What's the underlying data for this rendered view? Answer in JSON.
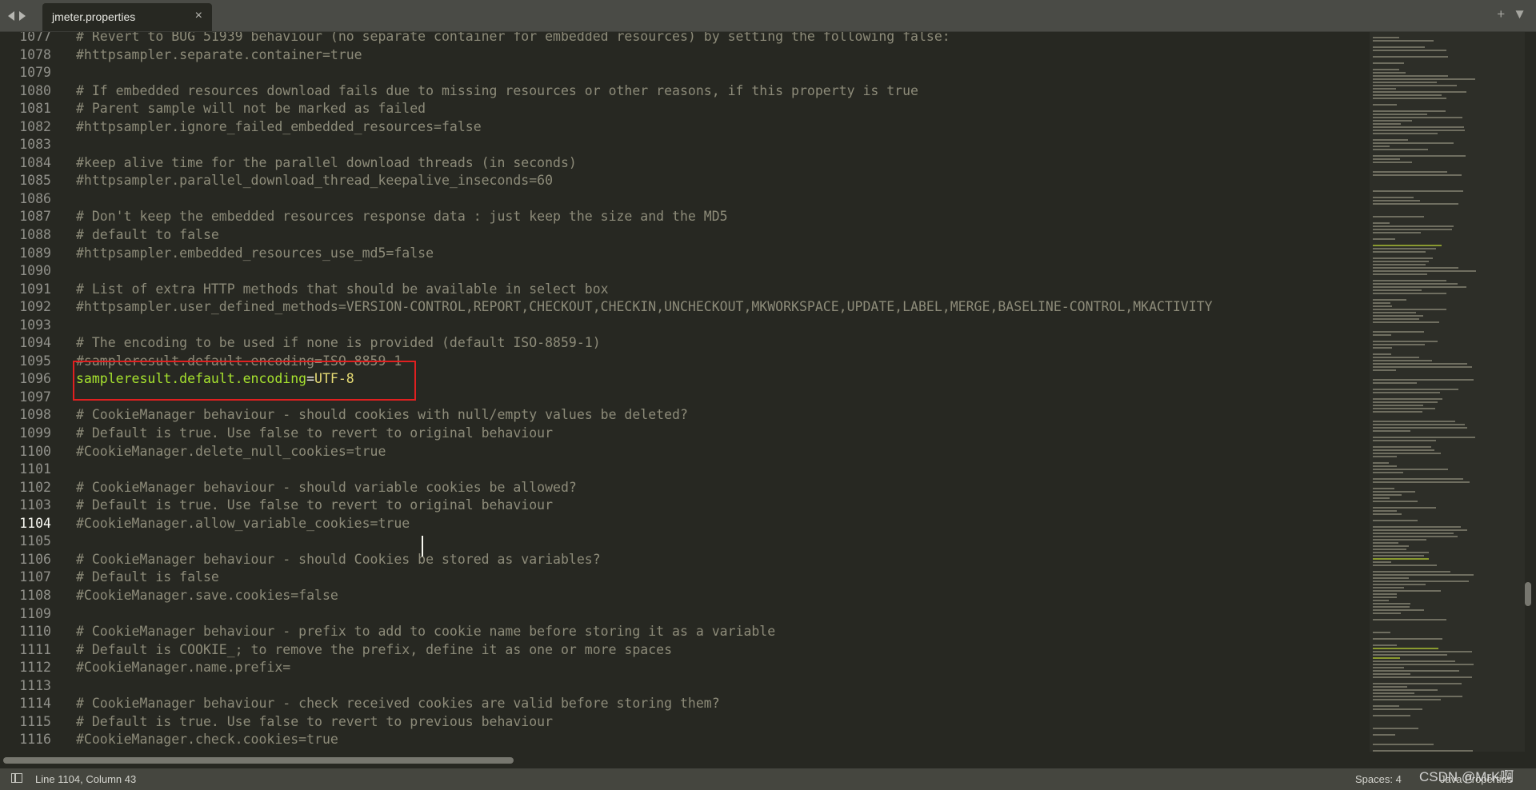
{
  "tabs": [
    {
      "label": "jmeter.properties",
      "close": "×"
    }
  ],
  "tab_actions": {
    "add": "+",
    "menu": "▼"
  },
  "editor": {
    "current_line": "1104",
    "lines": [
      {
        "num": "1077",
        "text": "# Revert to BUG 51939 behaviour (no separate container for embedded resources) by setting the following false:",
        "kind": "comment"
      },
      {
        "num": "1078",
        "text": "#httpsampler.separate.container=true",
        "kind": "comment"
      },
      {
        "num": "1079",
        "text": "",
        "kind": "comment"
      },
      {
        "num": "1080",
        "text": "# If embedded resources download fails due to missing resources or other reasons, if this property is true",
        "kind": "comment"
      },
      {
        "num": "1081",
        "text": "# Parent sample will not be marked as failed",
        "kind": "comment"
      },
      {
        "num": "1082",
        "text": "#httpsampler.ignore_failed_embedded_resources=false",
        "kind": "comment"
      },
      {
        "num": "1083",
        "text": "",
        "kind": "comment"
      },
      {
        "num": "1084",
        "text": "#keep alive time for the parallel download threads (in seconds)",
        "kind": "comment"
      },
      {
        "num": "1085",
        "text": "#httpsampler.parallel_download_thread_keepalive_inseconds=60",
        "kind": "comment"
      },
      {
        "num": "1086",
        "text": "",
        "kind": "comment"
      },
      {
        "num": "1087",
        "text": "# Don't keep the embedded resources response data : just keep the size and the MD5",
        "kind": "comment"
      },
      {
        "num": "1088",
        "text": "# default to false",
        "kind": "comment"
      },
      {
        "num": "1089",
        "text": "#httpsampler.embedded_resources_use_md5=false",
        "kind": "comment"
      },
      {
        "num": "1090",
        "text": "",
        "kind": "comment"
      },
      {
        "num": "1091",
        "text": "# List of extra HTTP methods that should be available in select box",
        "kind": "comment"
      },
      {
        "num": "1092",
        "text": "#httpsampler.user_defined_methods=VERSION-CONTROL,REPORT,CHECKOUT,CHECKIN,UNCHECKOUT,MKWORKSPACE,UPDATE,LABEL,MERGE,BASELINE-CONTROL,MKACTIVITY",
        "kind": "comment"
      },
      {
        "num": "1093",
        "text": "",
        "kind": "comment"
      },
      {
        "num": "1094",
        "text": "# The encoding to be used if none is provided (default ISO-8859-1)",
        "kind": "comment"
      },
      {
        "num": "1095",
        "text": "#sampleresult.default.encoding=ISO-8859-1",
        "kind": "comment"
      },
      {
        "num": "1096",
        "key": "sampleresult.default.encoding",
        "eq": "=",
        "val": "UTF-8",
        "kind": "property"
      },
      {
        "num": "1097",
        "text": "",
        "kind": "comment"
      },
      {
        "num": "1098",
        "text": "# CookieManager behaviour - should cookies with null/empty values be deleted?",
        "kind": "comment"
      },
      {
        "num": "1099",
        "text": "# Default is true. Use false to revert to original behaviour",
        "kind": "comment"
      },
      {
        "num": "1100",
        "text": "#CookieManager.delete_null_cookies=true",
        "kind": "comment"
      },
      {
        "num": "1101",
        "text": "",
        "kind": "comment"
      },
      {
        "num": "1102",
        "text": "# CookieManager behaviour - should variable cookies be allowed?",
        "kind": "comment"
      },
      {
        "num": "1103",
        "text": "# Default is true. Use false to revert to original behaviour",
        "kind": "comment"
      },
      {
        "num": "1104",
        "text": "#CookieManager.allow_variable_cookies=true",
        "kind": "comment"
      },
      {
        "num": "1105",
        "text": "",
        "kind": "comment"
      },
      {
        "num": "1106",
        "text": "# CookieManager behaviour - should Cookies be stored as variables?",
        "kind": "comment"
      },
      {
        "num": "1107",
        "text": "# Default is false",
        "kind": "comment"
      },
      {
        "num": "1108",
        "text": "#CookieManager.save.cookies=false",
        "kind": "comment"
      },
      {
        "num": "1109",
        "text": "",
        "kind": "comment"
      },
      {
        "num": "1110",
        "text": "# CookieManager behaviour - prefix to add to cookie name before storing it as a variable",
        "kind": "comment"
      },
      {
        "num": "1111",
        "text": "# Default is COOKIE_; to remove the prefix, define it as one or more spaces",
        "kind": "comment"
      },
      {
        "num": "1112",
        "text": "#CookieManager.name.prefix=",
        "kind": "comment"
      },
      {
        "num": "1113",
        "text": "",
        "kind": "comment"
      },
      {
        "num": "1114",
        "text": "# CookieManager behaviour - check received cookies are valid before storing them?",
        "kind": "comment"
      },
      {
        "num": "1115",
        "text": "# Default is true. Use false to revert to previous behaviour",
        "kind": "comment"
      },
      {
        "num": "1116",
        "text": "#CookieManager.check.cookies=true",
        "kind": "comment"
      }
    ]
  },
  "statusbar": {
    "position": "Line 1104, Column 43",
    "spaces": "Spaces: 4",
    "syntax": "Java Properties"
  },
  "watermark": "CSDN @MrK啊",
  "colors": {
    "background": "#272822",
    "comment": "#8d8b79",
    "key": "#a6e22e",
    "value": "#e6db74",
    "highlight_box": "#e02020"
  }
}
